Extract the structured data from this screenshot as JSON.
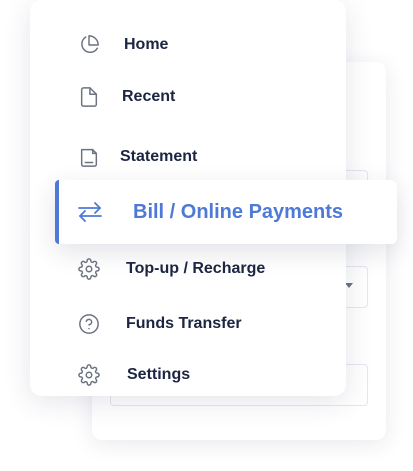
{
  "menu": {
    "items": [
      {
        "label": "Home",
        "icon": "pie-chart-icon"
      },
      {
        "label": "Recent",
        "icon": "document-icon"
      },
      {
        "label": "Statement",
        "icon": "documents-icon"
      },
      {
        "label": "Bill / Online Payments",
        "icon": "transfer-arrows-icon",
        "active": true
      },
      {
        "label": "Top-up / Recharge",
        "icon": "gear-icon"
      },
      {
        "label": "Funds Transfer",
        "icon": "help-circle-icon"
      },
      {
        "label": "Settings",
        "icon": "gear-icon"
      }
    ]
  },
  "colors": {
    "accent": "#4f79d6",
    "text": "#1c2541",
    "icon": "#6b7280"
  }
}
